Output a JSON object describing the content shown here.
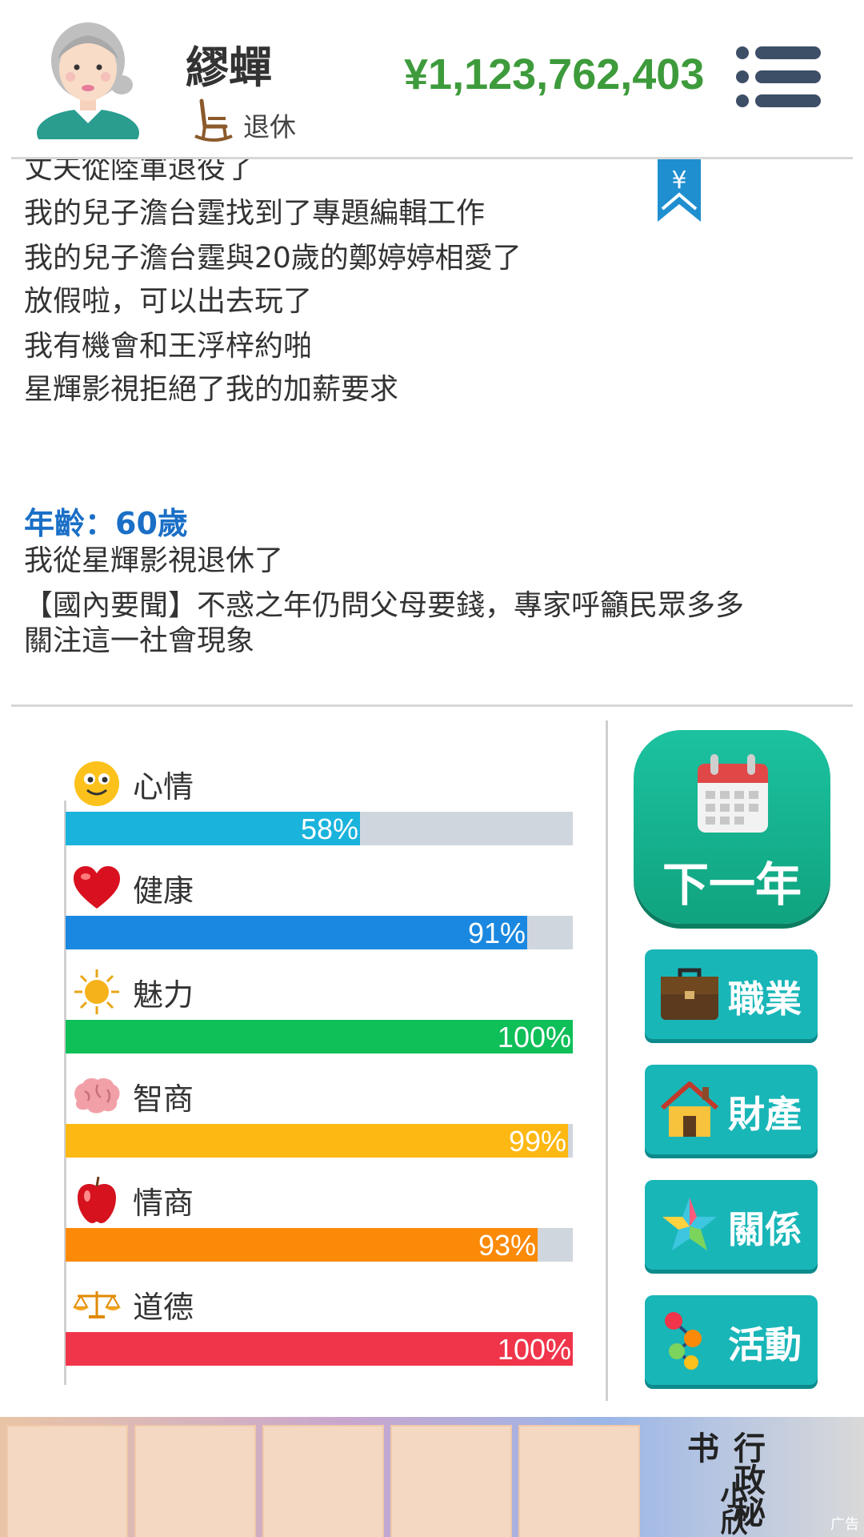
{
  "header": {
    "name": "繆蟬",
    "status": "退休",
    "money": "¥1,123,762,403"
  },
  "log": {
    "lines_before": [
      "丈夫從陸軍退役了",
      "我的兒子澹台霆找到了專題編輯工作",
      "我的兒子澹台霆與20歲的鄭婷婷相愛了",
      "放假啦，可以出去玩了",
      "我有機會和王浮梓約啪",
      "星輝影視拒絕了我的加薪要求"
    ],
    "age_label": "年齡：60歲",
    "lines_after": [
      "我從星輝影視退休了",
      "【國內要聞】不惑之年仍問父母要錢，專家呼籲民眾多多",
      "關注這一社會現象"
    ],
    "bookmark_symbol": "¥"
  },
  "stats": [
    {
      "label": "心情",
      "percent": 58,
      "display": "58%",
      "color": "#1ab3dc",
      "icon": "smiley-icon"
    },
    {
      "label": "健康",
      "percent": 91,
      "display": "91%",
      "color": "#1a88e0",
      "icon": "heart-icon"
    },
    {
      "label": "魅力",
      "percent": 100,
      "display": "100%",
      "color": "#0fbf58",
      "icon": "sun-icon"
    },
    {
      "label": "智商",
      "percent": 99,
      "display": "99%",
      "color": "#fdb813",
      "icon": "brain-icon"
    },
    {
      "label": "情商",
      "percent": 93,
      "display": "93%",
      "color": "#fb8a09",
      "icon": "apple-icon"
    },
    {
      "label": "道德",
      "percent": 100,
      "display": "100%",
      "color": "#f0354a",
      "icon": "scales-icon"
    }
  ],
  "actions": {
    "next_year": "下一年",
    "career": "職業",
    "property": "財產",
    "relations": "關係",
    "activities": "活動"
  },
  "ad": {
    "title_line1": "行政秘书",
    "title_line2": "小欣",
    "tag": "广告"
  }
}
